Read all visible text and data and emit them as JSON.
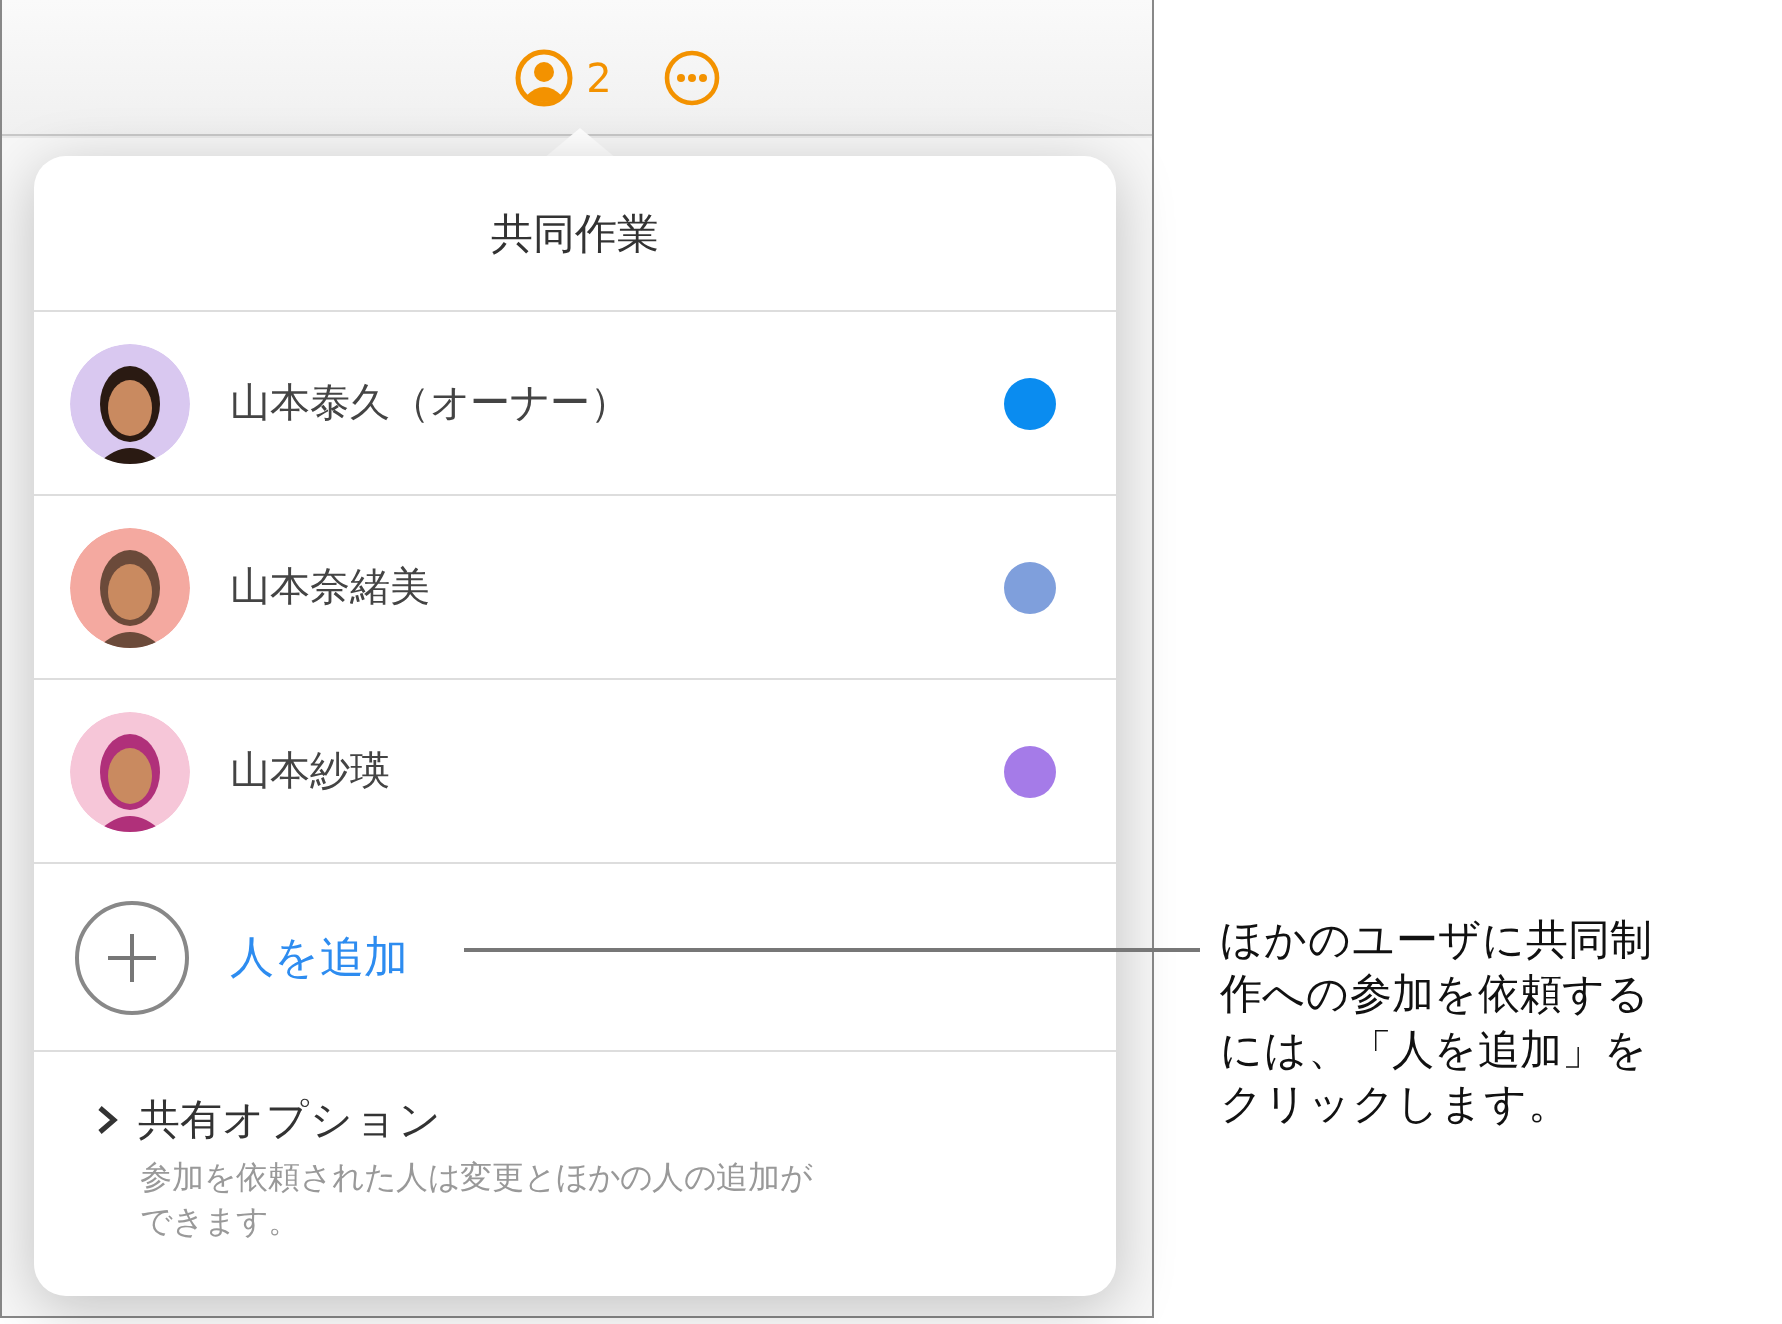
{
  "toolbar": {
    "collaborator_count": "2"
  },
  "popover": {
    "title": "共同作業",
    "participants": [
      {
        "name": "山本泰久（オーナー）",
        "color": "#0a8cf0"
      },
      {
        "name": "山本奈緒美",
        "color": "#7f9fdc"
      },
      {
        "name": "山本紗瑛",
        "color": "#a57be8"
      }
    ],
    "add_person": "人を追加",
    "share_options": {
      "title": "共有オプション",
      "expanded": false,
      "description": "参加を依頼された人は変更とほかの人の追加ができます。"
    }
  },
  "callout": "ほかのユーザに共同制作への参加を依頼するには、「人を追加」をクリックします。"
}
